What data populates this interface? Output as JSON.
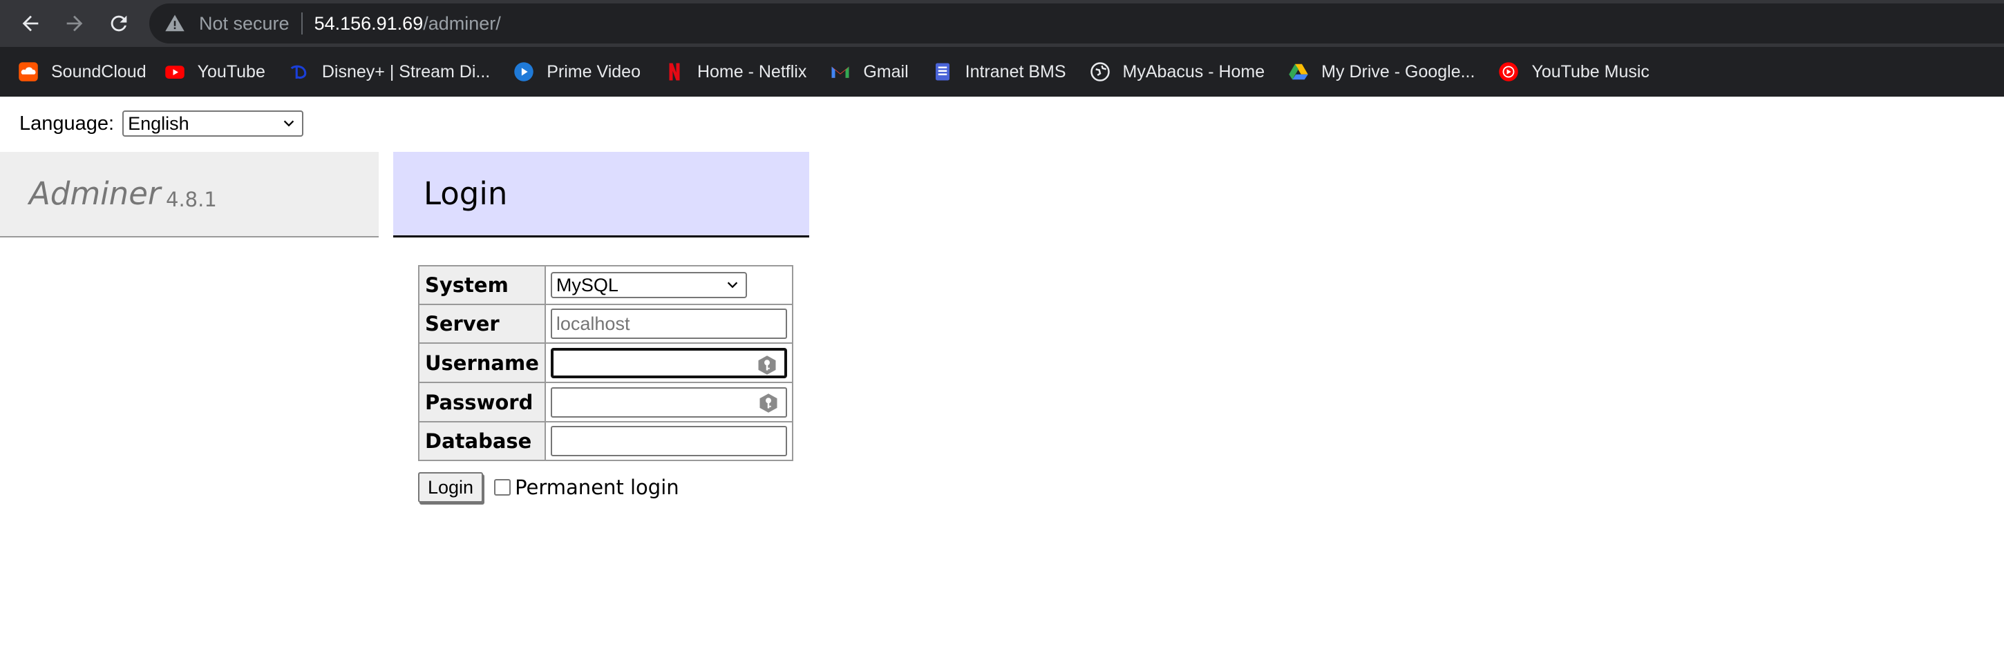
{
  "browser": {
    "security_label": "Not secure",
    "url_host": "54.156.91.69",
    "url_path": "/adminer/",
    "bookmarks": [
      {
        "label": "SoundCloud",
        "icon": "soundcloud-icon",
        "color": "#ff5500"
      },
      {
        "label": "YouTube",
        "icon": "youtube-icon",
        "color": "#ff0000"
      },
      {
        "label": "Disney+ | Stream Di...",
        "icon": "disney-plus-icon",
        "color": "#1a3fd8"
      },
      {
        "label": "Prime Video",
        "icon": "prime-video-icon",
        "color": "#1f7ad8"
      },
      {
        "label": "Home - Netflix",
        "icon": "netflix-icon",
        "color": "#e50914"
      },
      {
        "label": "Gmail",
        "icon": "gmail-icon",
        "color": "#ea4335"
      },
      {
        "label": "Intranet BMS",
        "icon": "intranet-icon",
        "color": "#4a64d8"
      },
      {
        "label": "MyAbacus - Home",
        "icon": "globe-icon",
        "color": "#e8eaed"
      },
      {
        "label": "My Drive - Google...",
        "icon": "google-drive-icon",
        "color": "#34a853"
      },
      {
        "label": "YouTube Music",
        "icon": "youtube-music-icon",
        "color": "#ff0000"
      }
    ]
  },
  "page": {
    "language_label": "Language:",
    "language_value": "English",
    "app_name": "Adminer",
    "app_version": "4.8.1",
    "heading": "Login",
    "form": {
      "system_label": "System",
      "system_value": "MySQL",
      "server_label": "Server",
      "server_placeholder": "localhost",
      "username_label": "Username",
      "username_value": "",
      "password_label": "Password",
      "database_label": "Database",
      "submit_label": "Login",
      "permanent_label": "Permanent login",
      "permanent_checked": false
    }
  }
}
